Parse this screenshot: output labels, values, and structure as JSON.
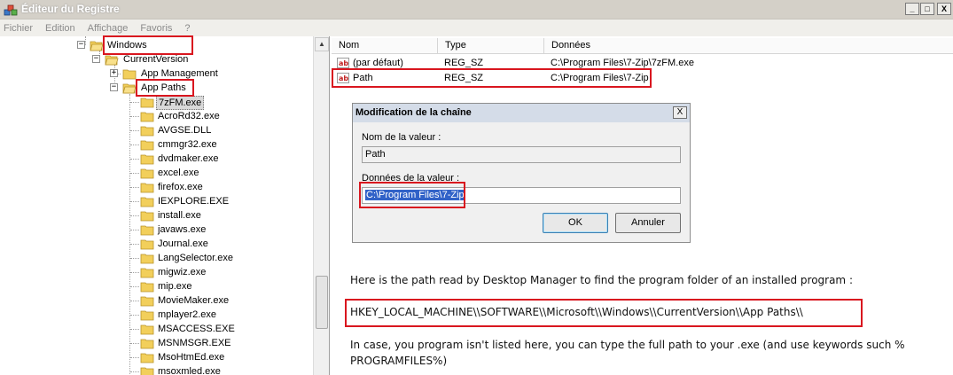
{
  "window": {
    "title": "Éditeur du Registre",
    "buttons": {
      "minimize": "_",
      "maximize": "□",
      "close": "X"
    }
  },
  "menu": [
    "Fichier",
    "Edition",
    "Affichage",
    "Favoris",
    "?"
  ],
  "tree": {
    "windows": "Windows",
    "current_version": "CurrentVersion",
    "app_management": "App Management",
    "app_paths": "App Paths",
    "children": [
      "7zFM.exe",
      "AcroRd32.exe",
      "AVGSE.DLL",
      "cmmgr32.exe",
      "dvdmaker.exe",
      "excel.exe",
      "firefox.exe",
      "IEXPLORE.EXE",
      "install.exe",
      "javaws.exe",
      "Journal.exe",
      "LangSelector.exe",
      "migwiz.exe",
      "mip.exe",
      "MovieMaker.exe",
      "mplayer2.exe",
      "MSACCESS.EXE",
      "MSNMSGR.EXE",
      "MsoHtmEd.exe",
      "msoxmled.exe"
    ],
    "selected": "7zFM.exe"
  },
  "list": {
    "columns": [
      "Nom",
      "Type",
      "Données"
    ],
    "rows": [
      {
        "name": "(par défaut)",
        "type": "REG_SZ",
        "data": "C:\\Program Files\\7-Zip\\7zFM.exe"
      },
      {
        "name": "Path",
        "type": "REG_SZ",
        "data": "C:\\Program Files\\7-Zip"
      }
    ]
  },
  "dialog": {
    "title": "Modification de la chaîne",
    "close": "X",
    "value_name_label": "Nom de la valeur :",
    "value_name": "Path",
    "value_data_label": "Données de la valeur :",
    "value_data": "C:\\Program Files\\7-Zip",
    "ok": "OK",
    "cancel": "Annuler"
  },
  "notes": {
    "intro": "Here is the path read by Desktop Manager to find the program folder of an installed program :",
    "registry_path": "HKEY_LOCAL_MACHINE\\\\SOFTWARE\\\\Microsoft\\\\Windows\\\\CurrentVersion\\\\App Paths\\\\",
    "fallback": "In case, you program isn't listed here, you can type the full path to your .exe (and use keywords such % PROGRAMFILES%)"
  },
  "colors": {
    "annotation_red": "#d9161f",
    "selection_blue": "#3162c8",
    "folder_yellow": "#f2cf5b"
  }
}
